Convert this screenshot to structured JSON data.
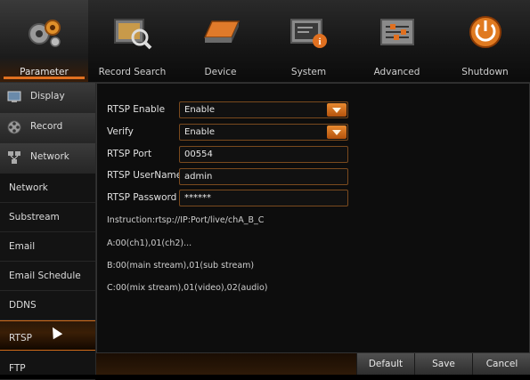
{
  "toolbar": {
    "items": [
      {
        "label": "Parameter",
        "icon": "gears-icon"
      },
      {
        "label": "Record Search",
        "icon": "film-search-icon"
      },
      {
        "label": "Device",
        "icon": "hard-drive-icon"
      },
      {
        "label": "System",
        "icon": "system-info-icon"
      },
      {
        "label": "Advanced",
        "icon": "sliders-icon"
      },
      {
        "label": "Shutdown",
        "icon": "power-icon"
      }
    ],
    "active": "Parameter"
  },
  "sidebar": {
    "items": [
      {
        "label": "Display",
        "type": "category",
        "icon": "monitor-icon"
      },
      {
        "label": "Record",
        "type": "category",
        "icon": "film-reel-icon"
      },
      {
        "label": "Network",
        "type": "category",
        "icon": "network-icon"
      },
      {
        "label": "Network",
        "type": "sub"
      },
      {
        "label": "Substream",
        "type": "sub"
      },
      {
        "label": "Email",
        "type": "sub"
      },
      {
        "label": "Email Schedule",
        "type": "sub"
      },
      {
        "label": "DDNS",
        "type": "sub"
      },
      {
        "label": "RTSP",
        "type": "sub",
        "selected": true
      },
      {
        "label": "FTP",
        "type": "sub"
      }
    ]
  },
  "form": {
    "rtsp_enable": {
      "label": "RTSP Enable",
      "value": "Enable"
    },
    "verify": {
      "label": "Verify",
      "value": "Enable"
    },
    "rtsp_port": {
      "label": "RTSP Port",
      "value": "00554"
    },
    "rtsp_username": {
      "label": "RTSP UserName",
      "value": "admin"
    },
    "rtsp_password": {
      "label": "RTSP Password",
      "value": "******"
    }
  },
  "info": {
    "instruction": "Instruction:rtsp://IP:Port/live/chA_B_C",
    "line_a": "A:00(ch1),01(ch2)...",
    "line_b": "B:00(main stream),01(sub stream)",
    "line_c": "C:00(mix stream),01(video),02(audio)"
  },
  "buttons": {
    "default": "Default",
    "save": "Save",
    "cancel": "Cancel"
  },
  "colors": {
    "accent": "#e07020",
    "field_border": "#7a4a1e"
  }
}
